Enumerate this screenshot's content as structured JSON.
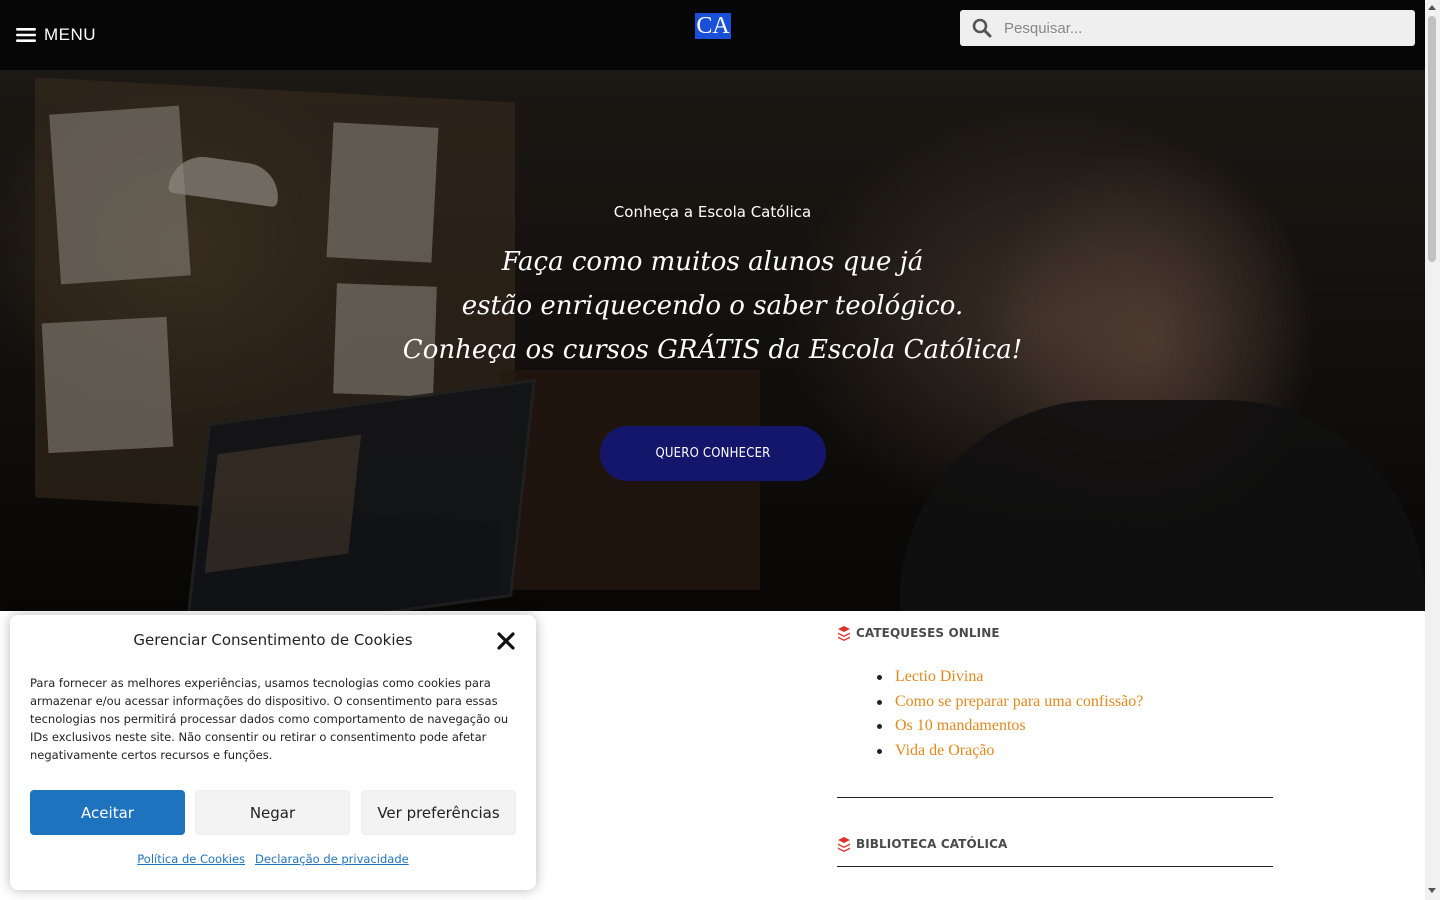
{
  "header": {
    "menu_label": "MENU",
    "logo_text": "CA",
    "search_placeholder": "Pesquisar..."
  },
  "hero": {
    "kicker": "Conheça a Escola Católica",
    "title_lines": [
      "Faça como muitos alunos que já",
      "estão enriquecendo o saber teológico.",
      "Conheça os cursos GRÁTIS da Escola Católica!"
    ],
    "cta_label": "QUERO CONHECER"
  },
  "sidebar": {
    "catequeses_title": "CATEQUESES ONLINE",
    "catequeses_items": [
      "Lectio Divina",
      "Como se preparar para uma confissão?",
      "Os 10 mandamentos",
      "Vida de Oração"
    ],
    "biblioteca_title": "BIBLIOTECA CATÓLICA"
  },
  "cookie": {
    "title": "Gerenciar Consentimento de Cookies",
    "text": "Para fornecer as melhores experiências, usamos tecnologias como cookies para armazenar e/ou acessar informações do dispositivo. O consentimento para essas tecnologias nos permitirá processar dados como comportamento de navegação ou IDs exclusivos neste site. Não consentir ou retirar o consentimento pode afetar negativamente certos recursos e funções.",
    "accept_label": "Aceitar",
    "deny_label": "Negar",
    "prefs_label": "Ver preferências",
    "cookie_policy_link": "Política de Cookies",
    "privacy_link": "Declaração de privacidade"
  },
  "colors": {
    "header_bg": "#060606",
    "cta_bg": "#14166b",
    "logo_bg": "#1a4fd8",
    "link_orange": "#e08a1e",
    "accept_blue": "#1e73be",
    "stack_icon_red": "#d9352a"
  }
}
